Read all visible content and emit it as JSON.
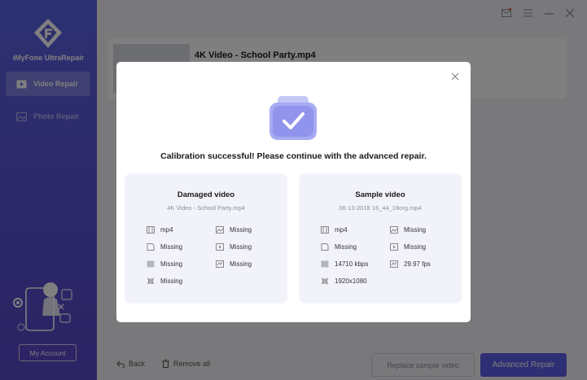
{
  "sidebar": {
    "app_name": "iMyFone UltraRepair",
    "items": [
      {
        "label": "Video Repair",
        "icon": "video-icon",
        "active": true
      },
      {
        "label": "Photo Repair",
        "icon": "photo-icon",
        "active": false
      }
    ],
    "account_label": "My Account"
  },
  "main": {
    "file_title": "4K Video - School Party.mp4"
  },
  "bottombar": {
    "back_label": "Back",
    "remove_label": "Remove all",
    "replace_label": "Replace sample video",
    "advanced_label": "Advanced Repair"
  },
  "modal": {
    "message": "Calibration successful! Please continue with the advanced repair.",
    "damaged": {
      "title": "Damaged video",
      "filename": "4K Video - School Party.mp4",
      "attrs": [
        "mp4",
        "Missing",
        "Missing",
        "Missing",
        "Missing",
        "Missing",
        "Missing"
      ]
    },
    "sample": {
      "title": "Sample video",
      "filename": "06-13-2018 16_44_18org.mp4",
      "attrs": [
        "mp4",
        "Missing",
        "Missing",
        "Missing",
        "14710 kbps",
        "29.97 fps",
        "1920x1080"
      ]
    }
  },
  "colors": {
    "accent": "#5b5ce6",
    "sidebar_top": "#5b62e3",
    "panel_bg": "#f2f3fa"
  }
}
